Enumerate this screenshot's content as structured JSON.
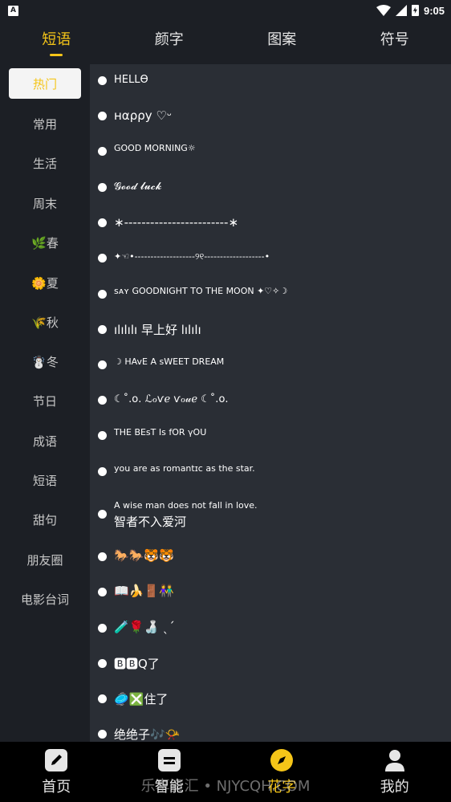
{
  "status_bar": {
    "notification_icon": "A",
    "time": "9:05",
    "icons": [
      "wifi-icon",
      "signal-icon",
      "battery-charging-icon"
    ]
  },
  "top_tabs": [
    {
      "label": "短语",
      "active": true
    },
    {
      "label": "颜字",
      "active": false
    },
    {
      "label": "图案",
      "active": false
    },
    {
      "label": "符号",
      "active": false
    }
  ],
  "sidebar": {
    "items": [
      {
        "label": "热门",
        "active": true
      },
      {
        "label": "常用"
      },
      {
        "label": "生活"
      },
      {
        "label": "周末"
      },
      {
        "label": "🌿春"
      },
      {
        "label": "🌼夏"
      },
      {
        "label": "🌾秋"
      },
      {
        "label": "☃️冬"
      },
      {
        "label": "节日"
      },
      {
        "label": "成语"
      },
      {
        "label": "短语"
      },
      {
        "label": "甜句"
      },
      {
        "label": "朋友圈"
      },
      {
        "label": "电影台词"
      }
    ]
  },
  "list": {
    "items": [
      {
        "text": "HELLѲ"
      },
      {
        "text": "нαρρу ♡ᵕ"
      },
      {
        "text": "GOOD MORNING☼"
      },
      {
        "text": "𝓖𝓸𝓸𝓭 𝓵𝓾𝓬𝓴"
      },
      {
        "text": "∗------------------------∗"
      },
      {
        "text": "✦☜•-------------------୨୧-------------------•"
      },
      {
        "text": "sᴀʏ GOODNIGHT TO THE MOON ✦♡✧☽"
      },
      {
        "text": "ılılılı 早上好 lılılı"
      },
      {
        "text": "☽ HAvE A sWEET DREAM"
      },
      {
        "text": "☾˚.ᴏ. ℒℴѵℯ ѵℴ𝓊ℯ ☾˚.ᴏ."
      },
      {
        "text": "THE  BEsT   Is   fOR   γOU"
      },
      {
        "text": "you are as romantɪc as the star."
      },
      {
        "text": "A wise man does not fall in love.",
        "line2": "智者不入爱河"
      },
      {
        "text": "🐎🐎🐯🐯"
      },
      {
        "text": "📖🍌🚪👫"
      },
      {
        "text": "🧪🌹🍶 ˎˊ"
      },
      {
        "text": "🅱🅱Q了"
      },
      {
        "text": "🥏❎住了"
      },
      {
        "text": "绝绝子🎶📯"
      }
    ]
  },
  "bottom_nav": [
    {
      "label": "首页",
      "icon": "pencil-icon",
      "active": false
    },
    {
      "label": "智能",
      "icon": "list-icon",
      "active": false
    },
    {
      "label": "花字",
      "icon": "compass-icon",
      "active": true
    },
    {
      "label": "我的",
      "icon": "user-icon",
      "active": false
    }
  ],
  "watermark": "乐享资汇 • NJYCQH.COM",
  "colors": {
    "accent": "#f5c518",
    "background": "#1c1f25",
    "list_bg": "#2a2e35",
    "nav_bg": "#000000"
  }
}
